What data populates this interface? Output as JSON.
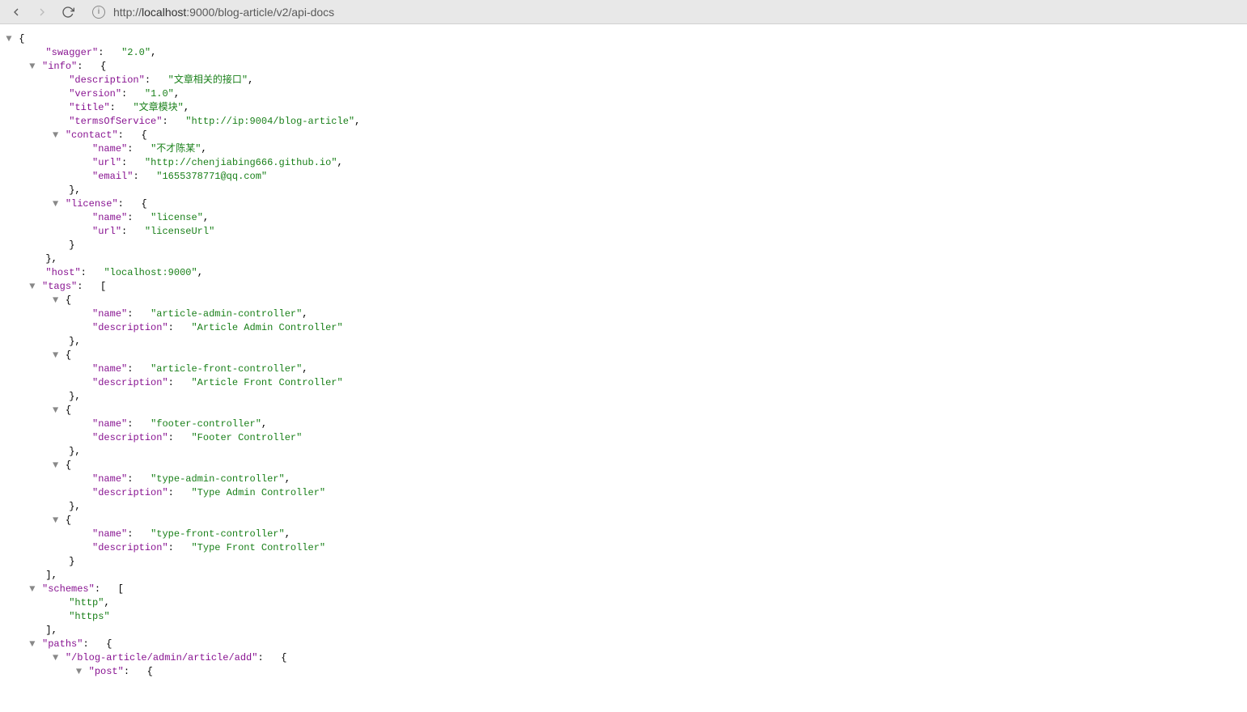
{
  "toolbar": {
    "url_prefix": "http://",
    "url_host": "localhost",
    "url_suffix": ":9000/blog-article/v2/api-docs"
  },
  "json": {
    "swagger": "2.0",
    "info": {
      "description": "文章相关的接口",
      "version": "1.0",
      "title": "文章模块",
      "termsOfService": "http://ip:9004/blog-article",
      "contact": {
        "name": "不才陈某",
        "url": "http://chenjiabing666.github.io",
        "email": "1655378771@qq.com"
      },
      "license": {
        "name": "license",
        "url": "licenseUrl"
      }
    },
    "host": "localhost:9000",
    "tags": [
      {
        "name": "article-admin-controller",
        "description": "Article Admin Controller"
      },
      {
        "name": "article-front-controller",
        "description": "Article Front Controller"
      },
      {
        "name": "footer-controller",
        "description": "Footer Controller"
      },
      {
        "name": "type-admin-controller",
        "description": "Type Admin Controller"
      },
      {
        "name": "type-front-controller",
        "description": "Type Front Controller"
      }
    ],
    "schemes": [
      "http",
      "https"
    ],
    "paths_key": "paths",
    "paths_first_key": "/blog-article/admin/article/add",
    "paths_first_method": "post"
  },
  "labels": {
    "swagger": "swagger",
    "info": "info",
    "description": "description",
    "version": "version",
    "title": "title",
    "termsOfService": "termsOfService",
    "contact": "contact",
    "name": "name",
    "url": "url",
    "email": "email",
    "license": "license",
    "host": "host",
    "tags": "tags",
    "schemes": "schemes",
    "paths": "paths"
  }
}
